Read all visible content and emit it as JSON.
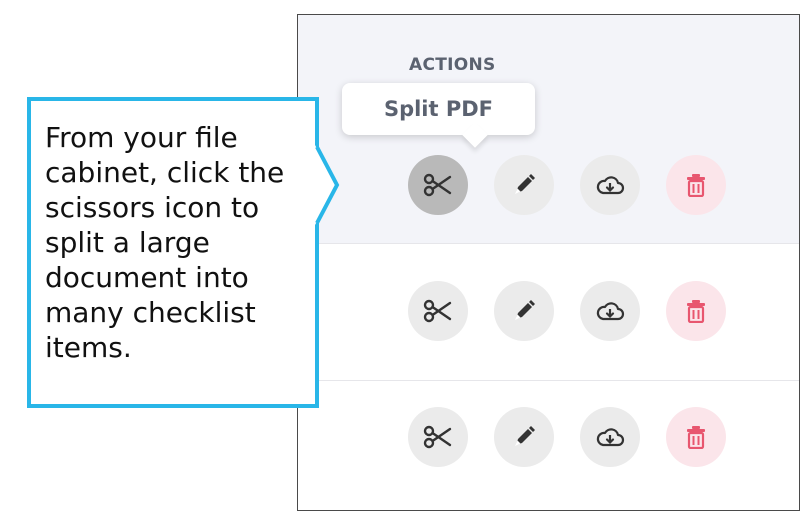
{
  "file_cabinet": {
    "header": "ACTIONS",
    "tooltip": "Split PDF",
    "rows": [
      {
        "highlighted": true,
        "actions": [
          {
            "icon": "scissors-icon",
            "state": "hover"
          },
          {
            "icon": "pencil-icon"
          },
          {
            "icon": "cloud-download-icon"
          },
          {
            "icon": "trash-icon"
          }
        ]
      },
      {
        "highlighted": false,
        "actions": [
          {
            "icon": "scissors-icon"
          },
          {
            "icon": "pencil-icon"
          },
          {
            "icon": "cloud-download-icon"
          },
          {
            "icon": "trash-icon"
          }
        ]
      },
      {
        "highlighted": false,
        "actions": [
          {
            "icon": "scissors-icon"
          },
          {
            "icon": "pencil-icon"
          },
          {
            "icon": "cloud-download-icon"
          },
          {
            "icon": "trash-icon"
          }
        ]
      }
    ]
  },
  "callout": {
    "lines": [
      "From your file",
      "cabinet, click the",
      "scissors icon to",
      "split a large",
      "document into",
      "many checklist",
      "items."
    ]
  },
  "colors": {
    "callout_border": "#29b6e8",
    "header_text": "#5b6270",
    "icon": "#333333",
    "trash_icon": "#e8566f",
    "trash_bg": "#fbe5ea",
    "button_bg": "#ebebeb",
    "button_active_bg": "#b9b9b9",
    "row_highlight_bg": "#f3f4f9"
  }
}
